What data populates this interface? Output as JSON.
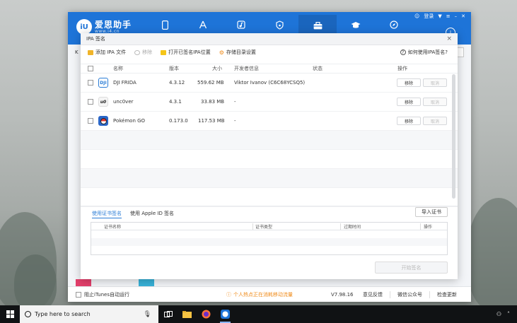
{
  "app": {
    "logo_badge": "iU",
    "logo_name": "爱思助手",
    "logo_url": "www.i4.cn",
    "nav_icons": [
      "phone-icon",
      "app-store-icon",
      "music-icon",
      "ringtone-icon",
      "toolbox-icon",
      "tutorial-icon",
      "compass-icon"
    ],
    "login": "登录",
    "side_letter": "K",
    "footer": {
      "itunes_label": "阻止iTunes自动运行",
      "notice": "个人热点正在消耗移动流量",
      "version": "V7.98.16",
      "feedback": "意见反馈",
      "wechat": "微信公众号",
      "update": "检查更新"
    }
  },
  "dialog": {
    "title": "IPA 签名",
    "toolbar": {
      "add": "添加 IPA 文件",
      "remove": "移除",
      "open_location": "打开已签名IPA位置",
      "storage_settings": "存储目录设置",
      "help": "如何使用IPA签名?"
    },
    "columns": {
      "name": "名称",
      "version": "版本",
      "size": "大小",
      "developer": "开发者信息",
      "status": "状态",
      "action": "操作"
    },
    "rows": [
      {
        "name": "DJI FRIDA",
        "icon": "DJI",
        "version": "4.3.12",
        "size": "559.62 MB",
        "developer": "Viktor Ivanov (C6C68YCSQ5)",
        "remove": "移除",
        "cancel": "取消"
      },
      {
        "name": "unc0ver",
        "icon": "u0",
        "version": "4.3.1",
        "size": "33.83 MB",
        "developer": "-",
        "remove": "移除",
        "cancel": "取消"
      },
      {
        "name": "Pokémon GO",
        "icon": "pokeball",
        "version": "0.173.0",
        "size": "117.53 MB",
        "developer": "-",
        "remove": "移除",
        "cancel": "取消"
      }
    ],
    "cert_tabs": [
      "使用证书签名",
      "使用 Apple ID 签名"
    ],
    "import_cert": "导入证书",
    "cert_columns": {
      "name": "证书名称",
      "type": "证书类型",
      "expiry": "过期时间",
      "action": "操作"
    },
    "start_sign": "开始签名"
  },
  "taskbar": {
    "search_placeholder": "Type here to search"
  },
  "colors": {
    "brand_blue": "#1e74d8",
    "notice_orange": "#f08c1b",
    "tab_active": "#2a7cd6"
  }
}
